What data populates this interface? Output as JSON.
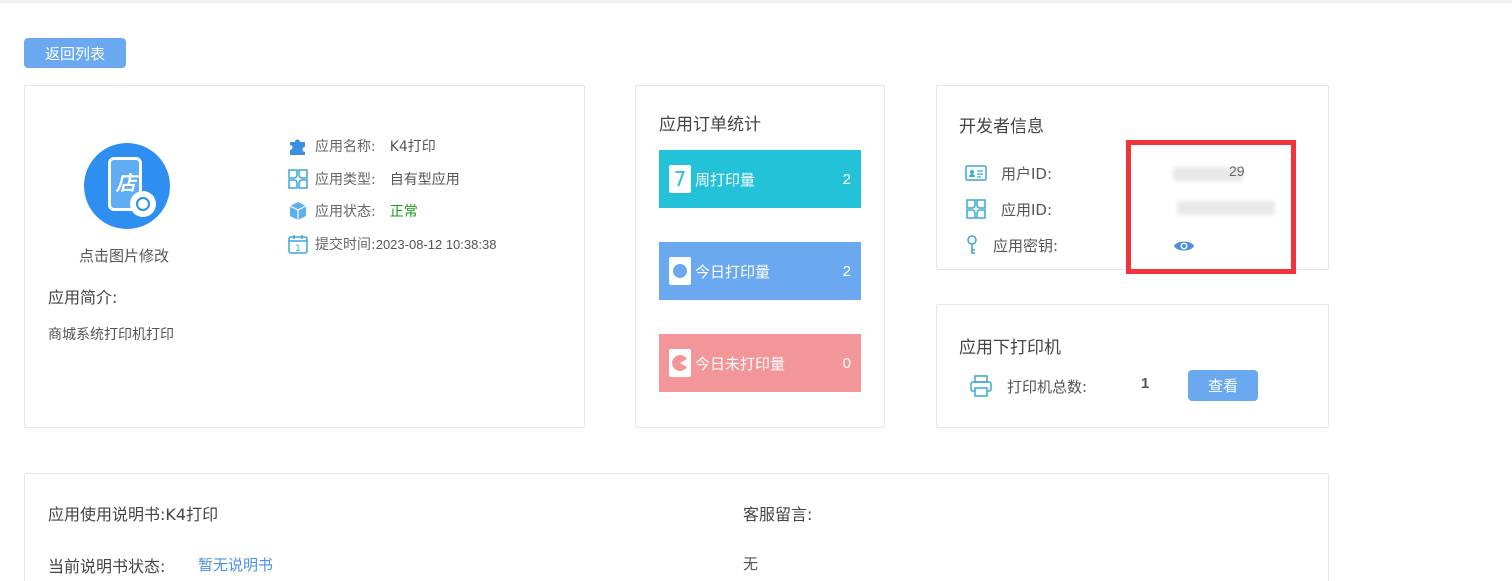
{
  "header": {
    "back_button": "返回列表"
  },
  "app": {
    "logo_caption": "点击图片修改",
    "intro_title": "应用简介:",
    "intro_text": "商城系统打印机打印",
    "logo_glyph": "店",
    "fields": [
      {
        "label": "应用名称:",
        "value": "K4打印",
        "icon": "puzzle-icon"
      },
      {
        "label": "应用类型:",
        "value": "自有型应用",
        "icon": "clover-icon"
      },
      {
        "label": "应用状态:",
        "value": "正常",
        "icon": "cube-icon",
        "color": "#1a9a1a"
      },
      {
        "label": "提交时间:",
        "value": "2023-08-12 10:38:38",
        "icon": "calendar-icon"
      }
    ]
  },
  "stats": {
    "title": "应用订单统计",
    "items": [
      {
        "label": "周打印量",
        "value": "2",
        "color": "#23c2d8",
        "icon": "seven-icon"
      },
      {
        "label": "今日打印量",
        "value": "2",
        "color": "#6aa9f0",
        "icon": "circle-icon"
      },
      {
        "label": "今日未打印量",
        "value": "0",
        "color": "#f2969a",
        "icon": "pacman-icon"
      }
    ]
  },
  "developer": {
    "title": "开发者信息",
    "user_id_label": "用户ID:",
    "user_id_value": "29",
    "app_id_label": "应用ID:",
    "secret_label": "应用密钥:"
  },
  "printers": {
    "title": "应用下打印机",
    "total_label": "打印机总数:",
    "total_value": "1",
    "view_button": "查看"
  },
  "manual": {
    "title": "应用使用说明书:K4打印",
    "status_label": "当前说明书状态:",
    "status_value": "暂无说明书",
    "message_title": "客服留言:",
    "message_value": "无"
  },
  "colors": {
    "accent": "#6aa9f0",
    "highlight_box": "#f0343c"
  }
}
